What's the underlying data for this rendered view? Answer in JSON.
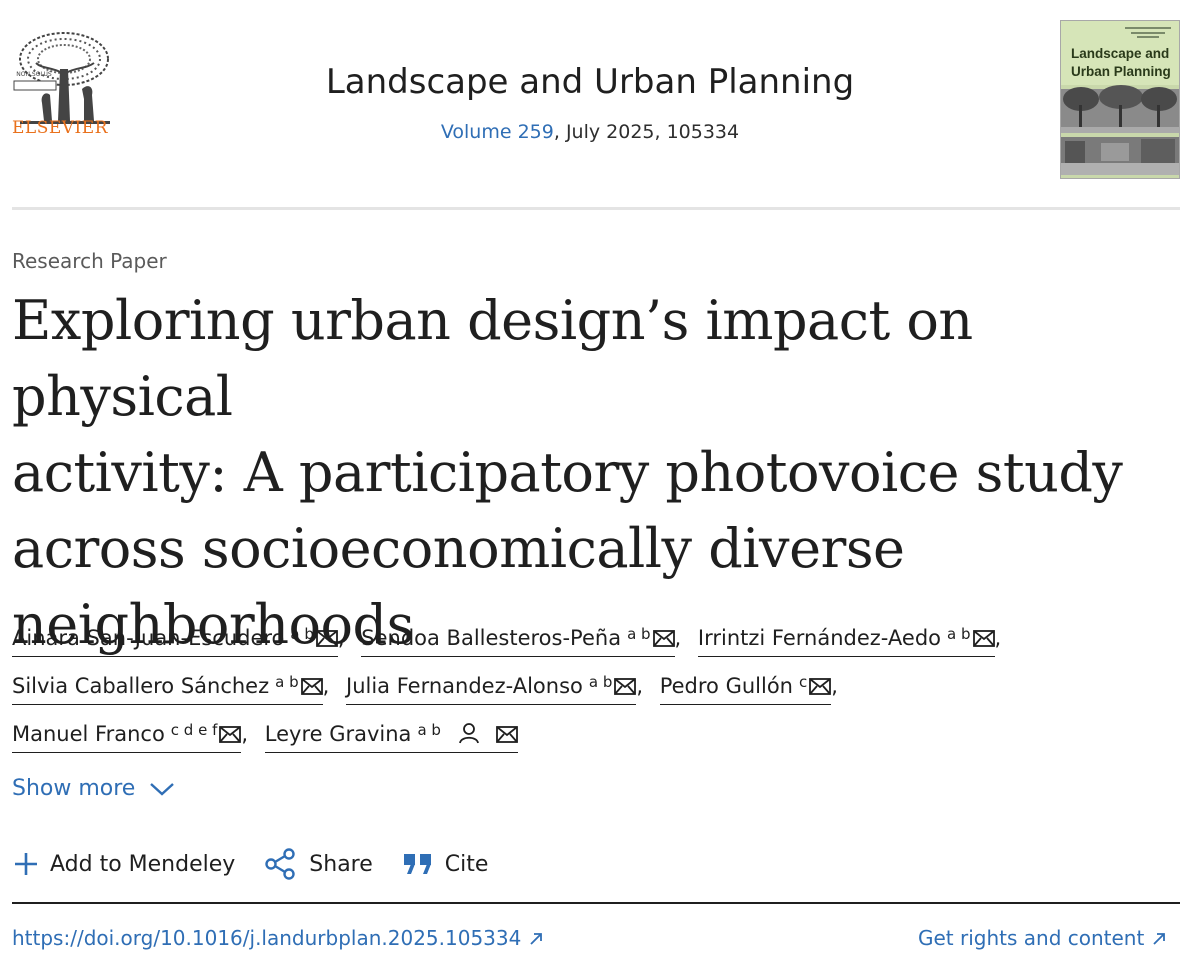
{
  "publisher": {
    "logo_name": "ELSEVIER",
    "logo_banner": "NON SOLUS"
  },
  "journal": {
    "title": "Landscape and Urban Planning",
    "volume_label": "Volume 259",
    "issue_rest": ", July 2025, 105334"
  },
  "cover": {
    "title_line1": "Landscape and",
    "title_line2": "Urban Planning"
  },
  "article": {
    "type": "Research Paper",
    "title_lines": [
      "Exploring urban design’s impact on physical",
      "activity: A participatory photovoice study",
      "across socioeconomically diverse",
      "neighborhoods"
    ]
  },
  "authors": [
    {
      "name": "Ainara San-Juan-Escudero",
      "affiliations": "a b",
      "person_icon": false,
      "trail": ","
    },
    {
      "name": "Sendoa Ballesteros-Peña",
      "affiliations": "a b",
      "person_icon": false,
      "trail": ","
    },
    {
      "name": "Irrintzi Fernández-Aedo",
      "affiliations": "a b",
      "person_icon": false,
      "trail": ","
    },
    {
      "name": "Silvia Caballero Sánchez",
      "affiliations": "a b",
      "person_icon": false,
      "trail": ","
    },
    {
      "name": "Julia Fernandez-Alonso",
      "affiliations": "a b",
      "person_icon": false,
      "trail": ","
    },
    {
      "name": "Pedro Gullón",
      "affiliations": "c",
      "person_icon": false,
      "trail": ","
    },
    {
      "name": "Manuel Franco",
      "affiliations": "c d e f",
      "person_icon": false,
      "trail": ","
    },
    {
      "name": "Leyre Gravina",
      "affiliations": "a b",
      "person_icon": true,
      "trail": ""
    }
  ],
  "show_more_label": "Show more",
  "actions": {
    "mendeley_label": "Add to Mendeley",
    "share_label": "Share",
    "cite_label": "Cite"
  },
  "footer": {
    "doi": "https://doi.org/10.1016/j.landurbplan.2025.105334",
    "rights": "Get rights and content"
  },
  "colors": {
    "link": "#2f6eb5",
    "elsevier_orange": "#e9711c",
    "text": "#1f1f1f"
  }
}
